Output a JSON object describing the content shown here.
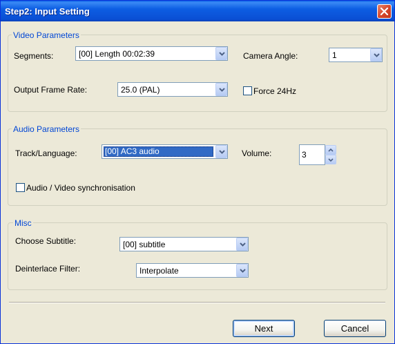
{
  "window": {
    "title": "Step2: Input Setting"
  },
  "video": {
    "legend": "Video Parameters",
    "segments_label": "Segments:",
    "segments_value": "[00] Length  00:02:39",
    "camera_label": "Camera Angle:",
    "camera_value": "1",
    "frame_rate_label": "Output Frame Rate:",
    "frame_rate_value": "25.0  (PAL)",
    "force_label": "Force 24Hz"
  },
  "audio": {
    "legend": "Audio Parameters",
    "track_label": "Track/Language:",
    "track_value": "[00] AC3 audio",
    "volume_label": "Volume:",
    "volume_value": "3",
    "sync_label": "Audio / Video synchronisation"
  },
  "misc": {
    "legend": "Misc",
    "subtitle_label": "Choose Subtitle:",
    "subtitle_value": "[00] subtitle",
    "deinterlace_label": "Deinterlace Filter:",
    "deinterlace_value": "Interpolate"
  },
  "buttons": {
    "next": "Next",
    "cancel": "Cancel"
  },
  "colors": {
    "title_bar": "#0a5fe6",
    "legend_text": "#0046d5",
    "selection": "#316ac5",
    "dialog_bg": "#ece9d8"
  }
}
